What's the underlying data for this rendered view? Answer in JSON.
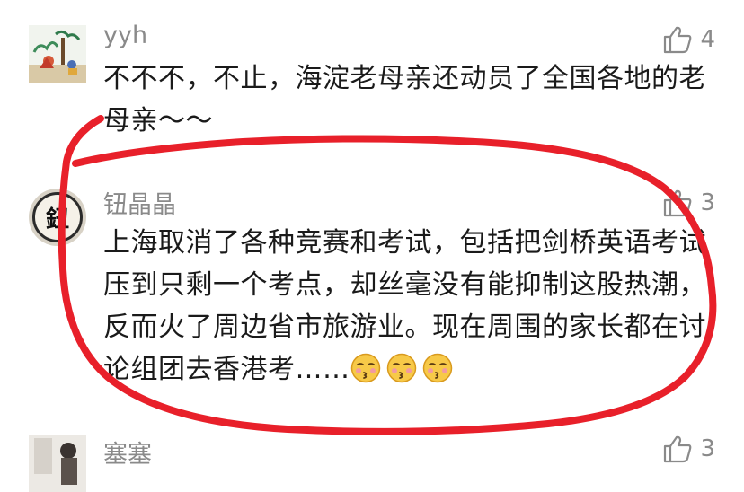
{
  "comments": [
    {
      "username": "yyh",
      "likes": "4",
      "text": "不不不，不止，海淀老母亲还动员了全国各地的老母亲～～"
    },
    {
      "username": "钮晶晶",
      "avatar_char": "鈕",
      "likes": "3",
      "text": "上海取消了各种竞赛和考试，包括把剑桥英语考试压到只剩一个考点，却丝毫没有能抑制这股热潮，反而火了周边省市旅游业。现在周围的家长都在讨论组团去香港考……"
    },
    {
      "username": "塞塞",
      "likes": "3"
    }
  ],
  "colors": {
    "annotation_ring": "#e8202a",
    "muted_text": "#8a8a8a"
  },
  "icons": {
    "like": "thumbs-up-icon",
    "emoji": "kissing-face-emoji"
  }
}
